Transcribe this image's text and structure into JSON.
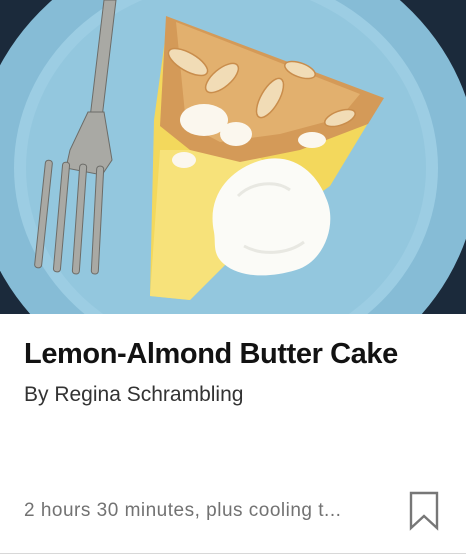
{
  "recipe": {
    "title": "Lemon-Almond Butter Cake",
    "byline": "By Regina Schrambling",
    "cook_time": "2 hours 30 minutes, plus cooling t...",
    "image_icon": "recipe-photo",
    "save_icon": "bookmark-icon"
  },
  "colors": {
    "plate": "#8ec4dd",
    "title_text": "#121212",
    "meta_text": "#727272"
  }
}
